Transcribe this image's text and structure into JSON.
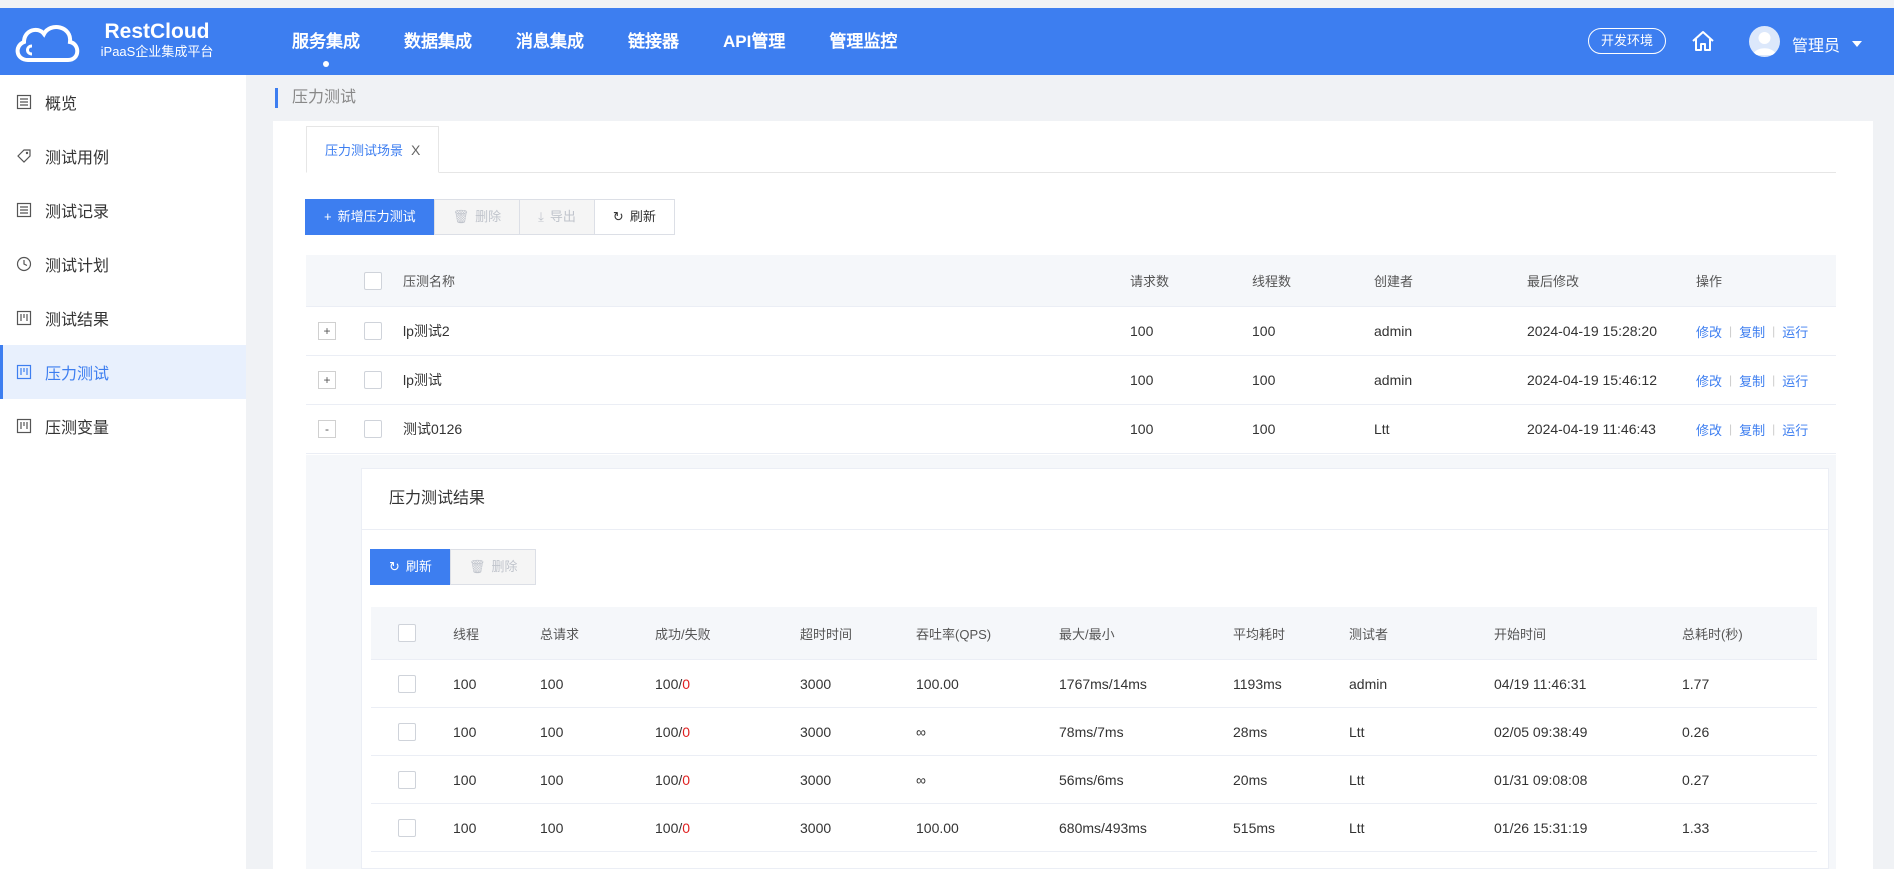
{
  "header": {
    "brand_name": "RestCloud",
    "brand_sub": "iPaaS企业集成平台",
    "nav": [
      "服务集成",
      "数据集成",
      "消息集成",
      "链接器",
      "API管理",
      "管理监控"
    ],
    "env_label": "开发环境",
    "user_name": "管理员"
  },
  "sidebar": {
    "items": [
      {
        "label": "概览",
        "icon": "list-icon"
      },
      {
        "label": "测试用例",
        "icon": "tag-icon"
      },
      {
        "label": "测试记录",
        "icon": "list-icon"
      },
      {
        "label": "测试计划",
        "icon": "clock-icon"
      },
      {
        "label": "测试结果",
        "icon": "board-icon"
      },
      {
        "label": "压力测试",
        "icon": "board-icon"
      },
      {
        "label": "压测变量",
        "icon": "board-icon"
      }
    ],
    "active": "压力测试"
  },
  "breadcrumb": "压力测试",
  "tab": {
    "label": "压力测试场景",
    "close": "X"
  },
  "toolbar": {
    "add": "新增压力测试",
    "delete": "删除",
    "export": "导出",
    "refresh": "刷新"
  },
  "main_table": {
    "columns": [
      "压测名称",
      "请求数",
      "线程数",
      "创建者",
      "最后修改",
      "操作"
    ],
    "actions": [
      "修改",
      "复制",
      "运行"
    ],
    "rows": [
      {
        "expand": "+",
        "name": "lp测试2",
        "requests": "100",
        "threads": "100",
        "creator": "admin",
        "modified": "2024-04-19 15:28:20"
      },
      {
        "expand": "+",
        "name": "lp测试",
        "requests": "100",
        "threads": "100",
        "creator": "admin",
        "modified": "2024-04-19 15:46:12"
      },
      {
        "expand": "-",
        "name": "测试0126",
        "requests": "100",
        "threads": "100",
        "creator": "Ltt",
        "modified": "2024-04-19 11:46:43"
      }
    ]
  },
  "results": {
    "title": "压力测试结果",
    "refresh": "刷新",
    "delete": "删除",
    "columns": [
      "线程",
      "总请求",
      "成功/失败",
      "超时时间",
      "吞吐率(QPS)",
      "最大/最小",
      "平均耗时",
      "测试者",
      "开始时间",
      "总耗时(秒)"
    ],
    "rows": [
      {
        "threads": "100",
        "total": "100",
        "success": "100",
        "fail": "0",
        "timeout": "3000",
        "qps": "100.00",
        "maxmin": "1767ms/14ms",
        "avg": "1193ms",
        "tester": "admin",
        "start": "04/19 11:46:31",
        "duration": "1.77"
      },
      {
        "threads": "100",
        "total": "100",
        "success": "100",
        "fail": "0",
        "timeout": "3000",
        "qps": "∞",
        "maxmin": "78ms/7ms",
        "avg": "28ms",
        "tester": "Ltt",
        "start": "02/05 09:38:49",
        "duration": "0.26"
      },
      {
        "threads": "100",
        "total": "100",
        "success": "100",
        "fail": "0",
        "timeout": "3000",
        "qps": "∞",
        "maxmin": "56ms/6ms",
        "avg": "20ms",
        "tester": "Ltt",
        "start": "01/31 09:08:08",
        "duration": "0.27"
      },
      {
        "threads": "100",
        "total": "100",
        "success": "100",
        "fail": "0",
        "timeout": "3000",
        "qps": "100.00",
        "maxmin": "680ms/493ms",
        "avg": "515ms",
        "tester": "Ltt",
        "start": "01/26 15:31:19",
        "duration": "1.33"
      }
    ]
  },
  "colors": {
    "primary": "#3d7ef0",
    "fail": "#e02020"
  }
}
